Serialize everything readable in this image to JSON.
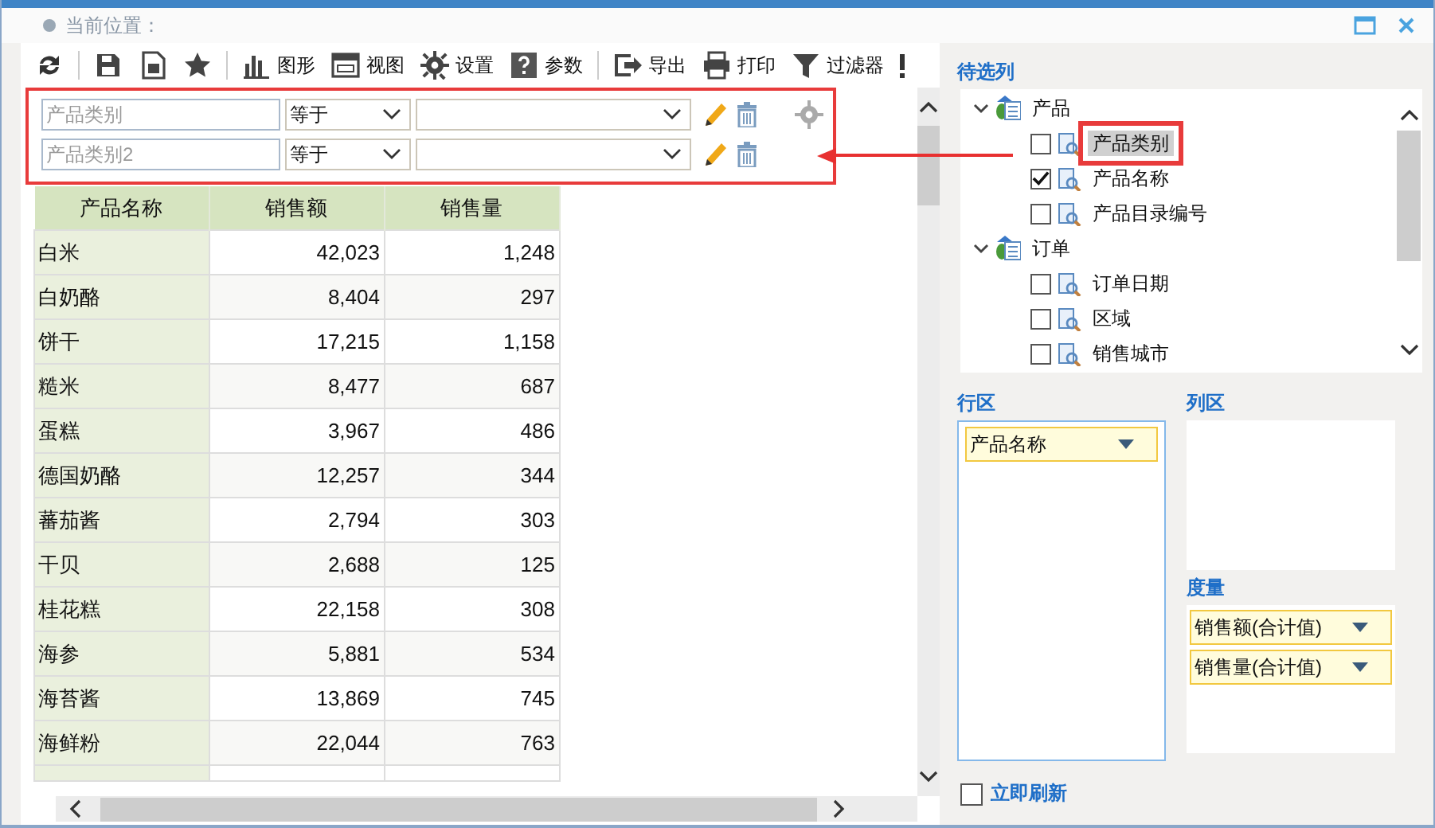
{
  "header": {
    "title": "当前位置："
  },
  "toolbar": [
    {
      "kind": "refresh"
    },
    {
      "kind": "save"
    },
    {
      "kind": "saveas"
    },
    {
      "kind": "star"
    },
    {
      "kind": "chart",
      "label": "图形"
    },
    {
      "kind": "view",
      "label": "视图"
    },
    {
      "kind": "gear",
      "label": "设置"
    },
    {
      "kind": "help",
      "label": "参数"
    },
    {
      "kind": "export",
      "label": "导出"
    },
    {
      "kind": "print",
      "label": "打印"
    },
    {
      "kind": "filter",
      "label": "过滤器"
    },
    {
      "kind": "alert"
    }
  ],
  "filters": [
    {
      "field": "产品类别",
      "operator": "等于",
      "settings": true
    },
    {
      "field": "产品类别2",
      "operator": "等于",
      "settings": false
    }
  ],
  "table": {
    "columns": [
      "产品名称",
      "销售额",
      "销售量"
    ],
    "rows": [
      [
        "白米",
        "42,023",
        "1,248"
      ],
      [
        "白奶酪",
        "8,404",
        "297"
      ],
      [
        "饼干",
        "17,215",
        "1,158"
      ],
      [
        "糙米",
        "8,477",
        "687"
      ],
      [
        "蛋糕",
        "3,967",
        "486"
      ],
      [
        "德国奶酪",
        "12,257",
        "344"
      ],
      [
        "蕃茄酱",
        "2,794",
        "303"
      ],
      [
        "干贝",
        "2,688",
        "125"
      ],
      [
        "桂花糕",
        "22,158",
        "308"
      ],
      [
        "海参",
        "5,881",
        "534"
      ],
      [
        "海苔酱",
        "13,869",
        "745"
      ],
      [
        "海鲜粉",
        "22,044",
        "763"
      ]
    ]
  },
  "side": {
    "title": "待选列",
    "tree": [
      {
        "label": "产品",
        "expanded": true,
        "children": [
          {
            "label": "产品类别",
            "checked": false,
            "selected": true
          },
          {
            "label": "产品名称",
            "checked": true,
            "selected": false
          },
          {
            "label": "产品目录编号",
            "checked": false,
            "selected": false
          }
        ]
      },
      {
        "label": "订单",
        "expanded": true,
        "children": [
          {
            "label": "订单日期",
            "checked": false,
            "selected": false
          },
          {
            "label": "区域",
            "checked": false,
            "selected": false
          },
          {
            "label": "销售城市",
            "checked": false,
            "selected": false
          }
        ]
      }
    ],
    "rows_title": "行区",
    "rows": [
      "产品名称"
    ],
    "cols_title": "列区",
    "measures_title": "度量",
    "measures": [
      "销售额(合计值)",
      "销售量(合计值)"
    ],
    "refresh": {
      "label": "立即刷新",
      "checked": false
    }
  }
}
